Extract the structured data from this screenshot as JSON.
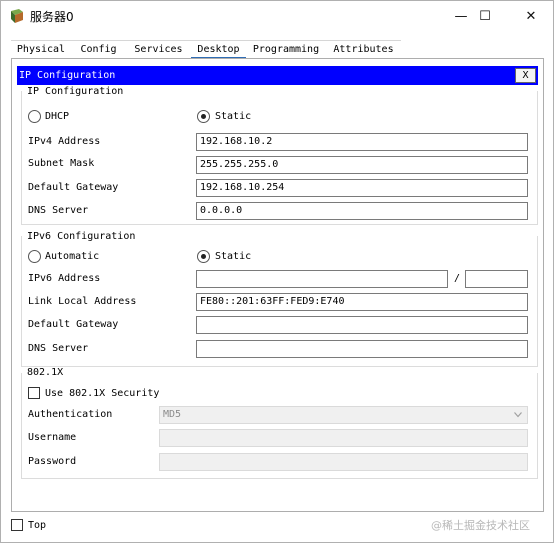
{
  "window": {
    "title": "服务器0",
    "minimize_glyph": "—",
    "maximize_glyph": "☐",
    "close_glyph": "✕"
  },
  "tabs": [
    {
      "label": "Physical",
      "active": false
    },
    {
      "label": "Config",
      "active": false
    },
    {
      "label": "Services",
      "active": false
    },
    {
      "label": "Desktop",
      "active": true
    },
    {
      "label": "Programming",
      "active": false
    },
    {
      "label": "Attributes",
      "active": false
    }
  ],
  "ip_config": {
    "header": "IP Configuration",
    "close_label": "X",
    "ipv4": {
      "section_label": "IP Configuration",
      "dhcp_label": "DHCP",
      "static_label": "Static",
      "mode": "static",
      "address_label": "IPv4 Address",
      "address": "192.168.10.2",
      "mask_label": "Subnet Mask",
      "mask": "255.255.255.0",
      "gateway_label": "Default Gateway",
      "gateway": "192.168.10.254",
      "dns_label": "DNS Server",
      "dns": "0.0.0.0"
    },
    "ipv6": {
      "section_label": "IPv6 Configuration",
      "auto_label": "Automatic",
      "static_label": "Static",
      "mode": "static",
      "address_label": "IPv6 Address",
      "address": "",
      "prefix_sep": "/",
      "prefix": "",
      "link_local_label": "Link Local Address",
      "link_local": "FE80::201:63FF:FED9:E740",
      "gateway_label": "Default Gateway",
      "gateway": "",
      "dns_label": "DNS Server",
      "dns": ""
    },
    "dot1x": {
      "section_label": "802.1X",
      "use_label": "Use 802.1X Security",
      "use_checked": false,
      "auth_label": "Authentication",
      "auth_value": "MD5",
      "username_label": "Username",
      "username": "",
      "password_label": "Password",
      "password": ""
    }
  },
  "footer": {
    "top_label": "Top",
    "top_checked": false,
    "watermark": "@稀土掘金技术社区"
  }
}
